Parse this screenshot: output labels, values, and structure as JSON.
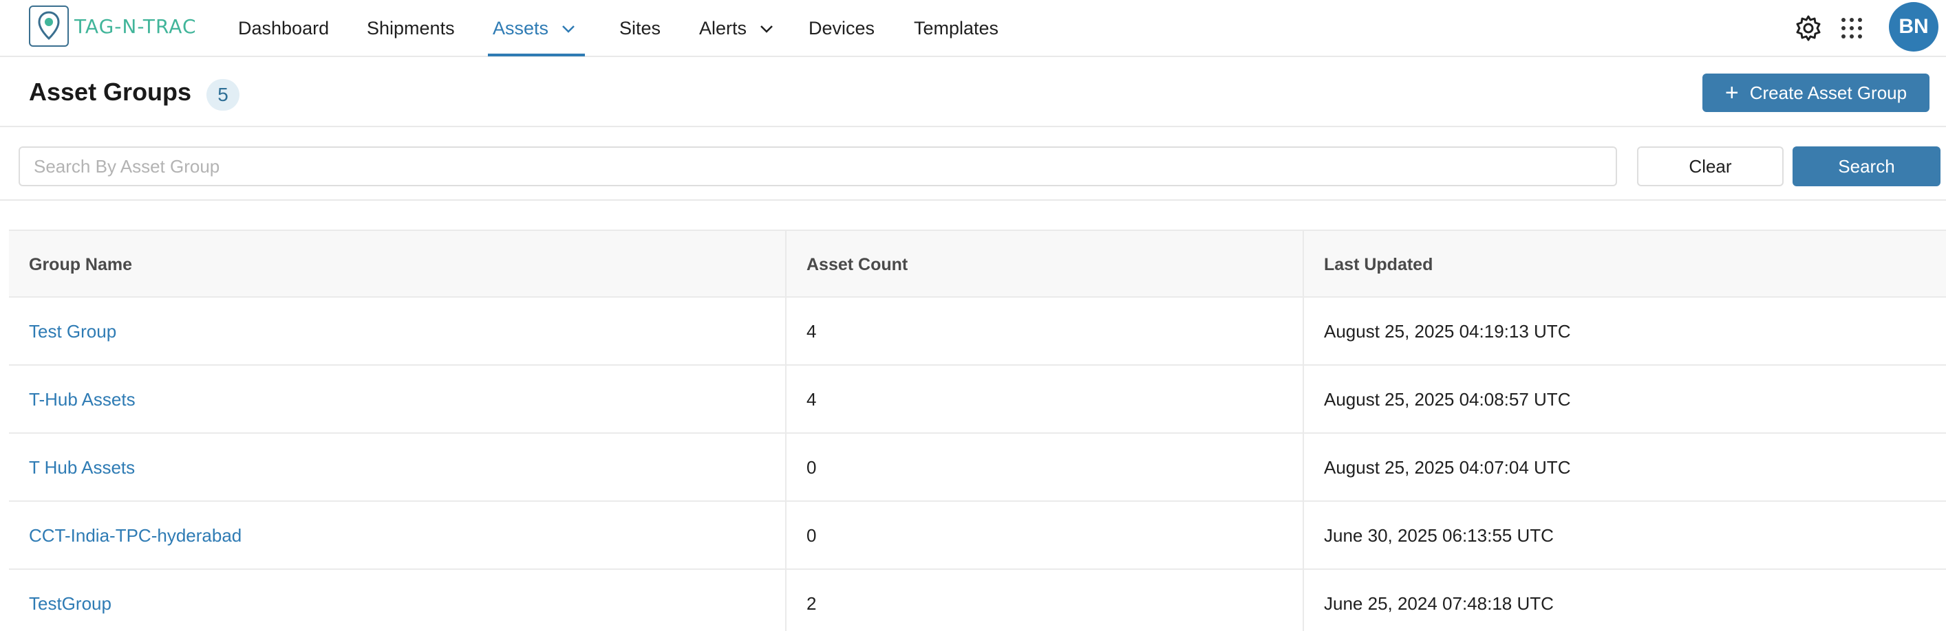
{
  "app": {
    "logo_text": "TAG-N-TRAC"
  },
  "nav": {
    "items": [
      {
        "label": "Dashboard"
      },
      {
        "label": "Shipments"
      },
      {
        "label": "Assets"
      },
      {
        "label": "Sites"
      },
      {
        "label": "Alerts"
      },
      {
        "label": "Devices"
      },
      {
        "label": "Templates"
      }
    ],
    "active": "Assets",
    "avatar_initials": "BN"
  },
  "header": {
    "title": "Asset Groups",
    "count": "5",
    "create_label": "Create Asset Group"
  },
  "search": {
    "placeholder": "Search By Asset Group",
    "value": "",
    "clear_label": "Clear",
    "search_label": "Search"
  },
  "table": {
    "columns": [
      "Group Name",
      "Asset Count",
      "Last Updated"
    ],
    "rows": [
      {
        "name": "Test Group",
        "count": "4",
        "updated": "August 25, 2025 04:19:13 UTC"
      },
      {
        "name": "T-Hub Assets",
        "count": "4",
        "updated": "August 25, 2025 04:08:57 UTC"
      },
      {
        "name": "T Hub Assets",
        "count": "0",
        "updated": "August 25, 2025 04:07:04 UTC"
      },
      {
        "name": "CCT-India-TPC-hyderabad",
        "count": "0",
        "updated": "June 30, 2025 06:13:55 UTC"
      },
      {
        "name": "TestGroup",
        "count": "2",
        "updated": "June 25, 2024 07:48:18 UTC"
      }
    ]
  },
  "colors": {
    "accent": "#2e7bb4",
    "button": "#3a7cad",
    "logo_green": "#41b59a"
  },
  "icons": [
    "location-pin-icon",
    "chevron-down-icon",
    "gear-icon",
    "apps-grid-icon",
    "plus-icon"
  ]
}
